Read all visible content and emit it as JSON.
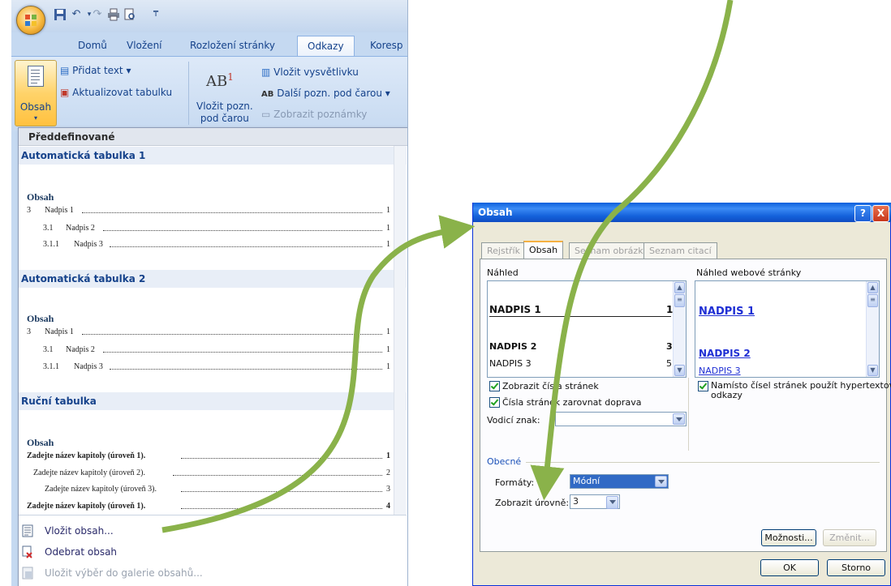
{
  "word": {
    "tabs": [
      "Domů",
      "Vložení",
      "Rozložení stránky",
      "Odkazy",
      "Koresp"
    ],
    "ribbon": {
      "obsah_label": "Obsah",
      "pridat_text": "Přidat text ▾",
      "aktualizovat": "Aktualizovat tabulku",
      "ab_big": "AB",
      "ab_sup": "1",
      "vlozit_pozn_line1": "Vložit pozn.",
      "vlozit_pozn_line2": "pod čarou",
      "vlozit_vysvetlivku": "Vložit vysvětlivku",
      "dalsi_pozn": "Další pozn. pod čarou ▾",
      "zobrazit_poznamky": "Zobrazit poznámky"
    },
    "gallery": {
      "header": "Předdefinované",
      "sections": [
        {
          "title": "Automatická tabulka 1",
          "toc_title": "Obsah",
          "rows": [
            {
              "num": "3",
              "text": "Nadpis 1",
              "page": "1"
            },
            {
              "num": "3.1",
              "text": "Nadpis 2",
              "page": "1"
            },
            {
              "num": "3.1.1",
              "text": "Nadpis 3",
              "page": "1"
            }
          ]
        },
        {
          "title": "Automatická tabulka 2",
          "toc_title": "Obsah",
          "rows": [
            {
              "num": "3",
              "text": "Nadpis 1",
              "page": "1"
            },
            {
              "num": "3.1",
              "text": "Nadpis 2",
              "page": "1"
            },
            {
              "num": "3.1.1",
              "text": "Nadpis 3",
              "page": "1"
            }
          ]
        },
        {
          "title": "Ruční tabulka",
          "toc_title": "Obsah",
          "rows": [
            {
              "text": "Zadejte název kapitoly (úroveň 1).",
              "page": "1"
            },
            {
              "text": "Zadejte název kapitoly (úroveň 2).",
              "page": "2"
            },
            {
              "text": "Zadejte název kapitoly (úroveň 3).",
              "page": "3"
            },
            {
              "text": "Zadejte název kapitoly (úroveň 1).",
              "page": "4"
            }
          ]
        }
      ],
      "footer": {
        "vlozit_obsah": "Vložit obsah...",
        "odebrat_obsah": "Odebrat obsah",
        "ulozit_vyber": "Uložit výběr do galerie obsahů..."
      }
    }
  },
  "dialog": {
    "title": "Obsah",
    "help_btn": "?",
    "close_btn": "X",
    "tabs": [
      "Rejstřík",
      "Obsah",
      "Seznam obrázků",
      "Seznam citací"
    ],
    "nahled_label": "Náhled",
    "nahled_web_label": "Náhled webové stránky",
    "preview": [
      {
        "text": "NADPIS 1",
        "page": "1"
      },
      {
        "text": "NADPIS 2",
        "page": "3"
      },
      {
        "text": "NADPIS 3",
        "page": "5"
      }
    ],
    "web_preview": [
      "NADPIS 1",
      "NADPIS 2",
      "NADPIS 3"
    ],
    "chk_zobrazit_cisla": "Zobrazit čísla stránek",
    "chk_zarovnat": "Čísla stránek zarovnat doprava",
    "vodici_znak_label": "Vodicí znak:",
    "vodici_znak_value": "",
    "chk_hypertext_line1": "Namísto čísel stránek použít hypertextové",
    "chk_hypertext_line2": "odkazy",
    "obecne_label": "Obecné",
    "formaty_label": "Formáty:",
    "formaty_value": "Módní",
    "urovne_label": "Zobrazit úrovně:",
    "urovne_value": "3",
    "moznosti_btn": "Možnosti...",
    "zmenit_btn": "Změnit...",
    "ok_btn": "OK",
    "storno_btn": "Storno"
  },
  "colors": {
    "arrow": "#8ab24a",
    "xp_title": "#0a5fdc",
    "ribbon_text": "#15428b"
  }
}
